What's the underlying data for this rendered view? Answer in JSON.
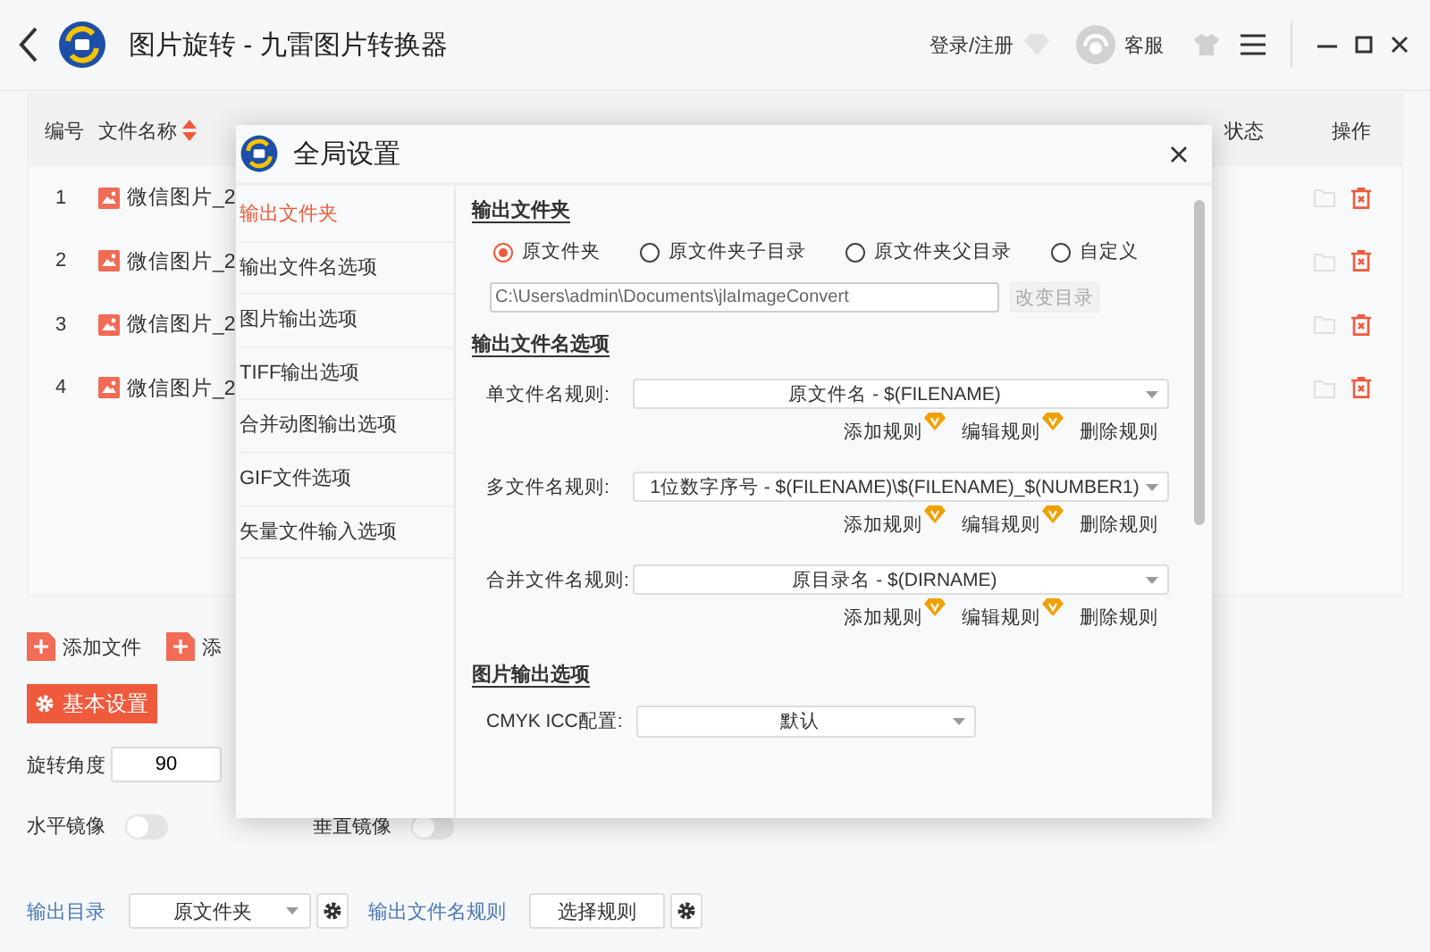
{
  "app": {
    "title": "图片旋转 - 九雷图片转换器"
  },
  "topbar": {
    "login": "登录/注册",
    "service": "客服"
  },
  "table": {
    "columns": [
      {
        "label": "编号",
        "kind": "plain"
      },
      {
        "label": "文件名称",
        "kind": "sortable"
      },
      {
        "label": "状态",
        "kind": "plain"
      },
      {
        "label": "操作",
        "kind": "plain"
      }
    ],
    "rows": [
      {
        "index": "1",
        "name": "微信图片_2"
      },
      {
        "index": "2",
        "name": "微信图片_2"
      },
      {
        "index": "3",
        "name": "微信图片_2"
      },
      {
        "index": "4",
        "name": "微信图片_2"
      }
    ]
  },
  "add_buttons": [
    "添加文件",
    "添"
  ],
  "basic_settings": "基本设置",
  "rotation": {
    "label": "旋转角度",
    "value": "90"
  },
  "mirrors": [
    {
      "label": "水平镜像",
      "on": false
    },
    {
      "label": "垂直镜像",
      "on": false
    }
  ],
  "output": {
    "dir_label": "输出目录",
    "dir_value": "原文件夹",
    "rule_label": "输出文件名规则",
    "rule_button": "选择规则"
  },
  "dialog": {
    "title": "全局设置",
    "nav": [
      {
        "label": "输出文件夹",
        "selected": true
      },
      {
        "label": "输出文件名选项",
        "selected": false
      },
      {
        "label": "图片输出选项",
        "selected": false
      },
      {
        "label": "TIFF输出选项",
        "selected": false
      },
      {
        "label": "合并动图输出选项",
        "selected": false
      },
      {
        "label": "GIF文件选项",
        "selected": false
      },
      {
        "label": "矢量文件输入选项",
        "selected": false
      }
    ],
    "folder": {
      "heading": "输出文件夹",
      "radios": [
        {
          "label": "原文件夹",
          "selected": true
        },
        {
          "label": "原文件夹子目录",
          "selected": false
        },
        {
          "label": "原文件夹父目录",
          "selected": false
        },
        {
          "label": "自定义",
          "selected": false
        }
      ],
      "path": "C:\\Users\\admin\\Documents\\jlaImageConvert",
      "change_button": {
        "label": "改变目录",
        "disabled": true
      }
    },
    "names": {
      "heading": "输出文件名选项",
      "rules": [
        {
          "label": "单文件名规则:",
          "value": "原文件名 - $(FILENAME)",
          "actions": [
            {
              "label": "添加规则",
              "vip": true
            },
            {
              "label": "编辑规则",
              "vip": true
            },
            {
              "label": "删除规则",
              "vip": false
            }
          ]
        },
        {
          "label": "多文件名规则:",
          "value": "1位数字序号 - $(FILENAME)\\$(FILENAME)_$(NUMBER1)",
          "actions": [
            {
              "label": "添加规则",
              "vip": true
            },
            {
              "label": "编辑规则",
              "vip": true
            },
            {
              "label": "删除规则",
              "vip": false
            }
          ]
        },
        {
          "label": "合并文件名规则:",
          "value": "原目录名 - $(DIRNAME)",
          "actions": [
            {
              "label": "添加规则",
              "vip": true
            },
            {
              "label": "编辑规则",
              "vip": true
            },
            {
              "label": "删除规则",
              "vip": false
            }
          ]
        }
      ]
    },
    "image": {
      "heading": "图片输出选项",
      "fields": [
        {
          "label": "CMYK ICC配置:",
          "value": "默认"
        }
      ]
    }
  }
}
